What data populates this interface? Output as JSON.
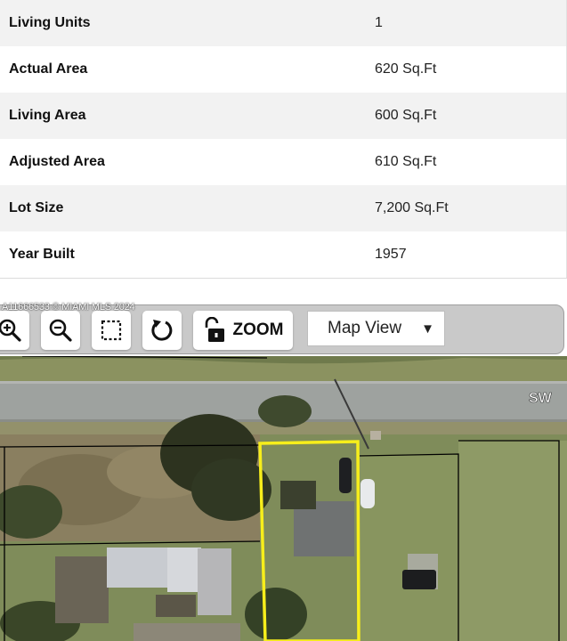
{
  "property_details": {
    "rows": [
      {
        "label": "Living Units",
        "value": "1"
      },
      {
        "label": "Actual Area",
        "value": "620 Sq.Ft"
      },
      {
        "label": "Living Area",
        "value": "600 Sq.Ft"
      },
      {
        "label": "Adjusted Area",
        "value": "610 Sq.Ft"
      },
      {
        "label": "Lot Size",
        "value": "7,200 Sq.Ft"
      },
      {
        "label": "Year Built",
        "value": "1957"
      }
    ]
  },
  "watermark": "A11666533 © MIAMI MLS 2024",
  "map_toolbar": {
    "buttons": [
      {
        "name": "zoom-in",
        "icon": "zoom-in-icon"
      },
      {
        "name": "zoom-out",
        "icon": "zoom-out-icon"
      },
      {
        "name": "select-area",
        "icon": "dashed-square-icon"
      },
      {
        "name": "rotate",
        "icon": "rotate-icon"
      },
      {
        "name": "zoom-lock",
        "icon": "unlock-icon"
      }
    ],
    "zoom_label": "ZOOM",
    "view_select": {
      "selected": "Map View"
    }
  },
  "map": {
    "street_label": "SW",
    "highlight_color": "#f7ee1b",
    "parcel_line_color": "#000000"
  }
}
